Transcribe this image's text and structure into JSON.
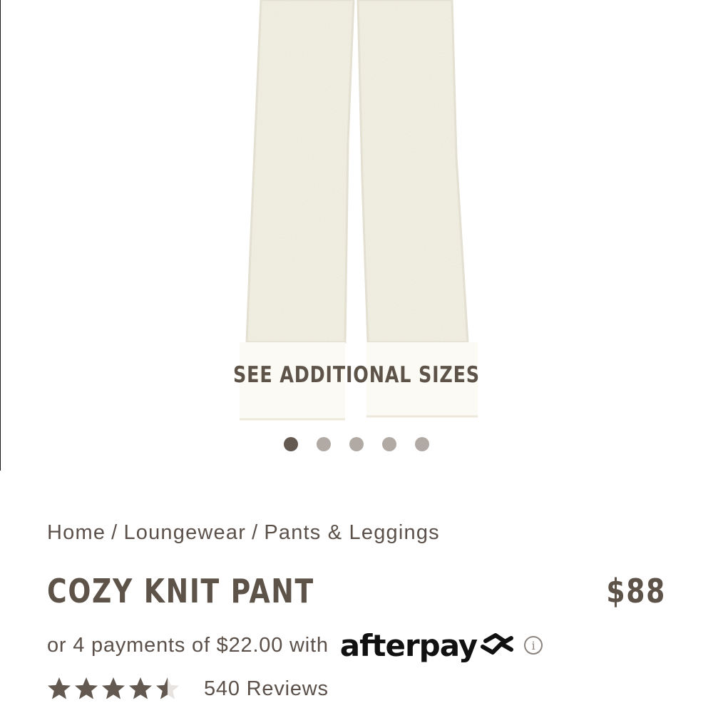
{
  "gallery": {
    "overlay_label": "SEE ADDITIONAL SIZES",
    "slide_count": 5,
    "active_slide": 1
  },
  "breadcrumb": {
    "items": [
      "Home",
      "Loungewear",
      "Pants & Leggings"
    ],
    "separator": "/"
  },
  "product": {
    "title": "COZY KNIT PANT",
    "price": "$88"
  },
  "payments": {
    "text": "or 4 payments of $22.00 with",
    "provider": "afterpay",
    "info_icon": "info-icon"
  },
  "rating": {
    "value": 4.5,
    "max": 5,
    "reviews_label": "540 Reviews"
  },
  "colors": {
    "text_primary": "#5e5349",
    "dot_active": "#645a52",
    "dot_inactive": "#b1aaa4",
    "star": "#635950",
    "fabric": "#f3f1e4"
  }
}
